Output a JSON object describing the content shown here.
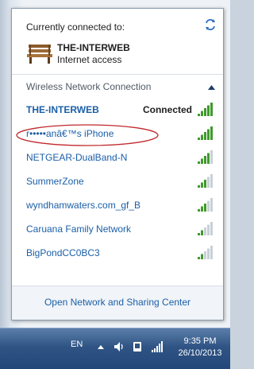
{
  "header": {
    "currently_connected_label": "Currently connected to:",
    "network_name": "THE-INTERWEB",
    "network_status": "Internet access",
    "refresh_icon": "refresh-icon",
    "network_icon": "bench-icon"
  },
  "section": {
    "title": "Wireless Network Connection",
    "collapse_icon": "chevron-up-icon"
  },
  "networks": [
    {
      "ssid": "THE-INTERWEB",
      "status": "Connected",
      "signal": 5,
      "bold": true
    },
    {
      "ssid": "r•••••anâ€™s iPhone",
      "status": "",
      "signal": 5,
      "bold": false
    },
    {
      "ssid": "NETGEAR-DualBand-N",
      "status": "",
      "signal": 4,
      "bold": false
    },
    {
      "ssid": "SummerZone",
      "status": "",
      "signal": 3,
      "bold": false
    },
    {
      "ssid": "wyndhamwaters.com_gf_B",
      "status": "",
      "signal": 3,
      "bold": false
    },
    {
      "ssid": "Caruana Family Network",
      "status": "",
      "signal": 2,
      "bold": false
    },
    {
      "ssid": "BigPondCC0BC3",
      "status": "",
      "signal": 2,
      "bold": false
    }
  ],
  "footer": {
    "link": "Open Network and Sharing Center"
  },
  "taskbar": {
    "language": "EN",
    "time": "9:35 PM",
    "date": "26/10/2013"
  },
  "colors": {
    "link": "#1a5fa8",
    "signal_active": "#3f9a2c",
    "signal_inactive": "#c8d0d8",
    "annotation": "#c0282d"
  }
}
